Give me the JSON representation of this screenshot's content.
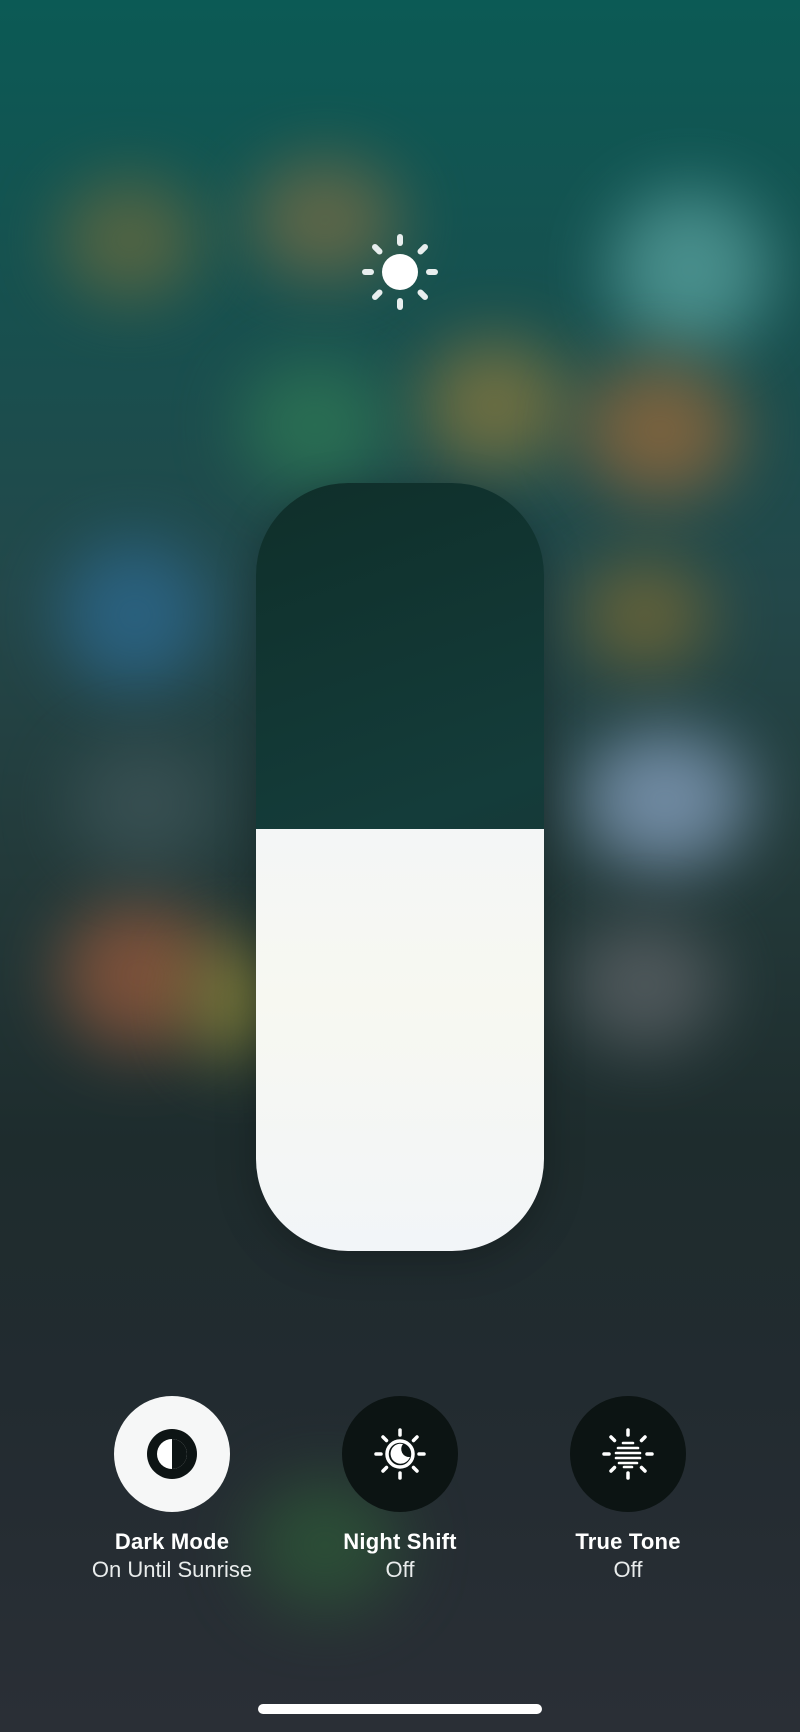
{
  "brightness": {
    "icon": "sun-icon",
    "level": 0.55
  },
  "controls": [
    {
      "icon": "dark-mode-icon",
      "title": "Dark Mode",
      "subtitle": "On Until Sunrise",
      "on": true
    },
    {
      "icon": "night-shift-icon",
      "title": "Night Shift",
      "subtitle": "Off",
      "on": false
    },
    {
      "icon": "true-tone-icon",
      "title": "True Tone",
      "subtitle": "Off",
      "on": false
    }
  ],
  "colors": {
    "slider_fill": "#f4f6f6",
    "control_on": "#f6f7f7",
    "control_off": "#0c1413"
  }
}
